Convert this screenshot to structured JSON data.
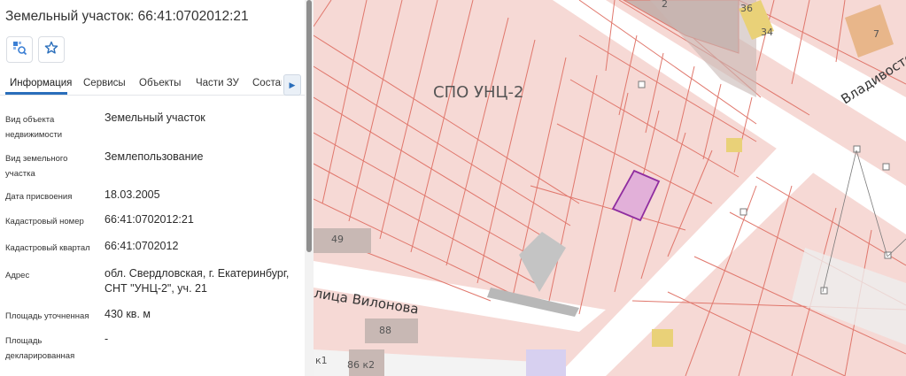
{
  "title": "Земельный участок: 66:41:0702012:21",
  "toolbar": {
    "locate_icon": "map-search-icon",
    "favorite_icon": "star-outline-icon"
  },
  "tabs": [
    {
      "label": "Информация",
      "active": true
    },
    {
      "label": "Сервисы",
      "active": false
    },
    {
      "label": "Объекты",
      "active": false
    },
    {
      "label": "Части ЗУ",
      "active": false
    },
    {
      "label": "Состав",
      "active": false
    }
  ],
  "tab_scroll_icon": "triangle-right-icon",
  "properties": [
    {
      "label": "Вид объекта недвижимости",
      "value": "Земельный участок"
    },
    {
      "label": "Вид земельного участка",
      "value": "Землепользование"
    },
    {
      "label": "Дата присвоения",
      "value": "18.03.2005"
    },
    {
      "label": "Кадастровый номер",
      "value": "66:41:0702012:21"
    },
    {
      "label": "Кадастровый квартал",
      "value": "66:41:0702012"
    },
    {
      "label": "Адрес",
      "value": "обл. Свердловская, г. Екатеринбург, СНТ \"УНЦ-2\", уч. 21"
    },
    {
      "label": "Площадь уточненная",
      "value": "430 кв. м"
    },
    {
      "label": "Площадь декларированная",
      "value": "-"
    }
  ],
  "map": {
    "area_label": "СПО УНЦ-2",
    "street_1": "лица Вилонова",
    "street_2": "Владивосто",
    "building_labels": [
      "2",
      "36",
      "34",
      "7",
      "49",
      "88",
      "86 к2",
      "к1"
    ],
    "colors": {
      "parcel_fill": "#f6d9d5",
      "parcel_stroke": "#e0776c",
      "road": "#ffffff",
      "building": "#c8b8b4",
      "highlight_fill": "#e2b0d9",
      "highlight_stroke": "#8f2da0",
      "yellow_building": "#e9d178",
      "orange_building": "#e8b68a"
    }
  }
}
